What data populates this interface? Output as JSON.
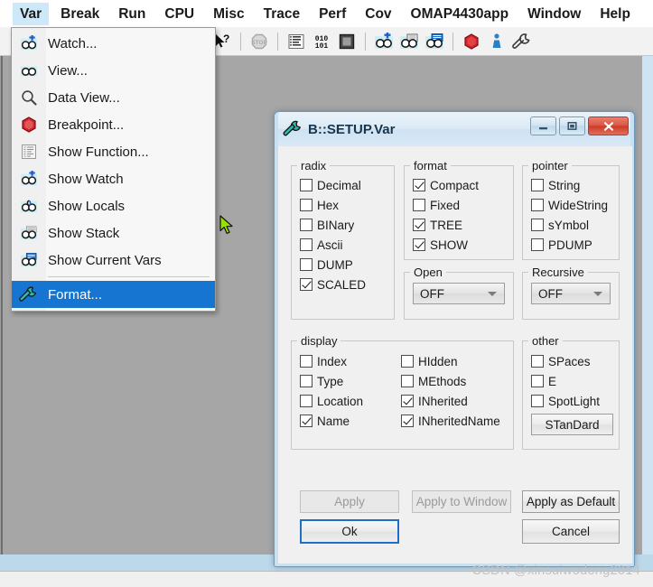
{
  "app": {
    "menubar": [
      {
        "label": "Var",
        "open": true
      },
      {
        "label": "Break",
        "open": false
      },
      {
        "label": "Run",
        "open": false
      },
      {
        "label": "CPU",
        "open": false
      },
      {
        "label": "Misc",
        "open": false
      },
      {
        "label": "Trace",
        "open": false
      },
      {
        "label": "Perf",
        "open": false
      },
      {
        "label": "Cov",
        "open": false
      },
      {
        "label": "OMAP4430app",
        "open": false
      },
      {
        "label": "Window",
        "open": false
      },
      {
        "label": "Help",
        "open": false
      }
    ],
    "toolbar": [
      {
        "name": "help-pointer-icon"
      },
      {
        "name": "stop-icon"
      },
      {
        "name": "list-icon"
      },
      {
        "name": "binary-010-101-icon"
      },
      {
        "name": "chip-icon"
      },
      {
        "name": "watch-add-icon"
      },
      {
        "name": "view-icon"
      },
      {
        "name": "show-current-vars-icon"
      },
      {
        "name": "breakpoint-icon"
      },
      {
        "name": "info-icon"
      },
      {
        "name": "wrench-icon"
      }
    ]
  },
  "var_menu": {
    "items": [
      {
        "label": "Watch...",
        "icon": "watch-add-icon",
        "highlight": false
      },
      {
        "label": "View...",
        "icon": "view-glasses-icon",
        "highlight": false
      },
      {
        "label": "Data View...",
        "icon": "magnifier-icon",
        "highlight": false
      },
      {
        "label": "Breakpoint...",
        "icon": "breakpoint-icon",
        "highlight": false
      },
      {
        "label": "Show Function...",
        "icon": "function-list-icon",
        "highlight": false
      },
      {
        "label": "Show Watch",
        "icon": "watch-add-icon",
        "highlight": false
      },
      {
        "label": "Show Locals",
        "icon": "locals-icon",
        "highlight": false
      },
      {
        "label": "Show Stack",
        "icon": "stack-icon",
        "highlight": false
      },
      {
        "label": "Show Current Vars",
        "icon": "current-vars-icon",
        "highlight": false
      },
      {
        "label": "Format...",
        "icon": "wrench-icon",
        "highlight": true
      }
    ],
    "separator_after_index": 8
  },
  "dialog": {
    "title": "B::SETUP.Var",
    "title_icon": "wrench-icon",
    "window_buttons": [
      {
        "name": "minimize-button",
        "glyph": "minimize"
      },
      {
        "name": "maximize-button",
        "glyph": "maximize"
      },
      {
        "name": "close-button",
        "glyph": "close"
      }
    ],
    "groups": {
      "radix": {
        "legend": "radix",
        "checkboxes": [
          {
            "label": "Decimal",
            "checked": false
          },
          {
            "label": "Hex",
            "checked": false
          },
          {
            "label": "BINary",
            "checked": false
          },
          {
            "label": "Ascii",
            "checked": false
          },
          {
            "label": "DUMP",
            "checked": false
          },
          {
            "label": "SCALED",
            "checked": true
          }
        ]
      },
      "format": {
        "legend": "format",
        "checkboxes": [
          {
            "label": "Compact",
            "checked": true
          },
          {
            "label": "Fixed",
            "checked": false
          },
          {
            "label": "TREE",
            "checked": true
          },
          {
            "label": "SHOW",
            "checked": true
          }
        ]
      },
      "pointer": {
        "legend": "pointer",
        "checkboxes": [
          {
            "label": "String",
            "checked": false
          },
          {
            "label": "WideString",
            "checked": false
          },
          {
            "label": "sYmbol",
            "checked": false
          },
          {
            "label": "PDUMP",
            "checked": false
          }
        ]
      },
      "open": {
        "legend": "Open",
        "select_value": "OFF"
      },
      "recursive": {
        "legend": "Recursive",
        "select_value": "OFF"
      },
      "display": {
        "legend": "display",
        "column1": [
          {
            "label": "Index",
            "checked": false
          },
          {
            "label": "Type",
            "checked": false
          },
          {
            "label": "Location",
            "checked": false
          },
          {
            "label": "Name",
            "checked": true
          }
        ],
        "column2": [
          {
            "label": "HIdden",
            "checked": false
          },
          {
            "label": "MEthods",
            "checked": false
          },
          {
            "label": "INherited",
            "checked": true
          },
          {
            "label": "INheritedName",
            "checked": true
          }
        ]
      },
      "other": {
        "legend": "other",
        "checkboxes": [
          {
            "label": "SPaces",
            "checked": false
          },
          {
            "label": "E",
            "checked": false
          },
          {
            "label": "SpotLight",
            "checked": false
          }
        ],
        "button_label": "STanDard"
      }
    },
    "buttons": {
      "apply": {
        "label": "Apply",
        "disabled": true
      },
      "apply_to_window": {
        "label": "Apply to Window",
        "disabled": true
      },
      "apply_as_default": {
        "label": "Apply as Default",
        "disabled": false
      },
      "ok": {
        "label": "Ok",
        "disabled": false,
        "focused": true
      },
      "cancel": {
        "label": "Cancel",
        "disabled": false
      }
    }
  },
  "watermark": "CSDN @xinsuiwodong2014",
  "colors": {
    "menu_highlight": "#1675d1",
    "menubar_open": "#cde8f8",
    "dialog_frame": "#c9e0f0",
    "close_button": "#cb3a26",
    "focus_border": "#1f6fc4",
    "cursor": "#97e000"
  }
}
